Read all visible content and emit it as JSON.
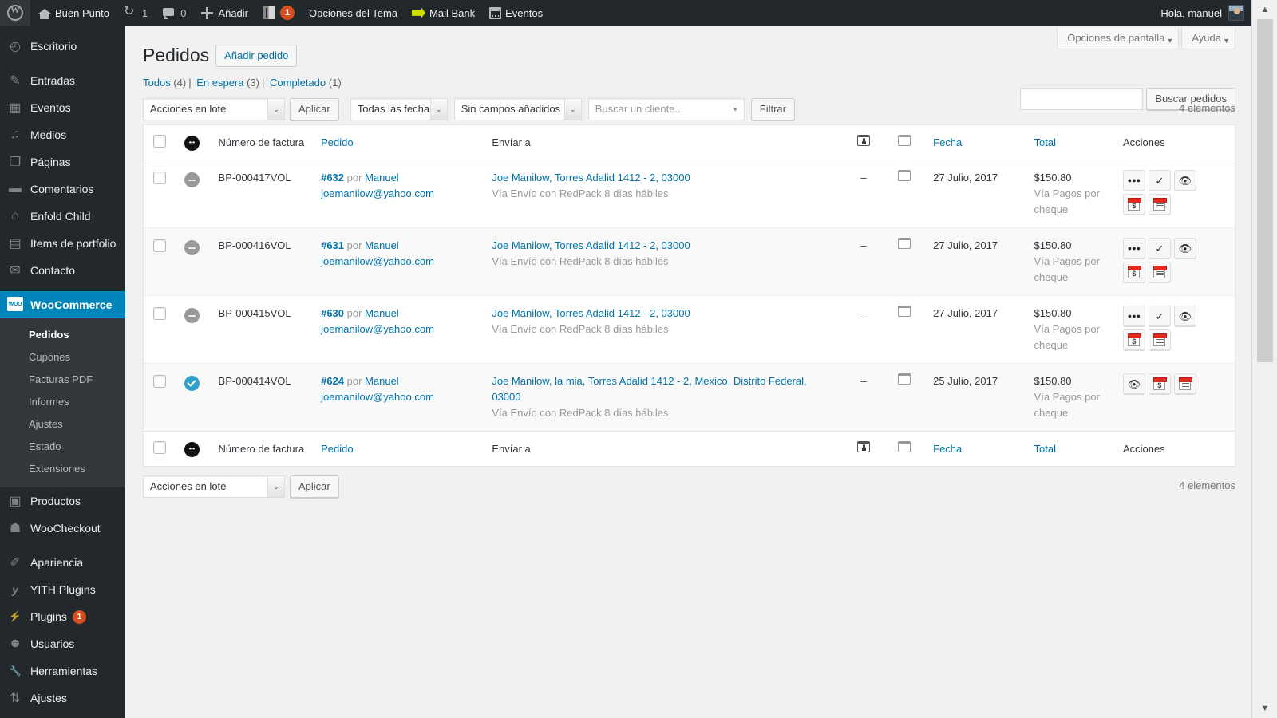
{
  "adminbar": {
    "logo_icon": "wordpress-logo-icon",
    "site_name": "Buen Punto",
    "updates_count": "1",
    "comments_count": "0",
    "new_label": "Añadir",
    "theme_badge": "1",
    "theme_options_label": "Opciones del Tema",
    "mail_bank_label": "Mail Bank",
    "events_label": "Eventos",
    "greeting": "Hola, manuel"
  },
  "sidebar": {
    "items": [
      {
        "label": "Escritorio",
        "icon": "dashboard-icon",
        "glyph": "◴",
        "current": false
      },
      {
        "label": "Entradas",
        "icon": "pin-icon",
        "glyph": "✎",
        "current": false
      },
      {
        "label": "Eventos",
        "icon": "calendar-icon",
        "glyph": "▦",
        "current": false
      },
      {
        "label": "Medios",
        "icon": "media-icon",
        "glyph": "♪",
        "current": false
      },
      {
        "label": "Páginas",
        "icon": "pages-icon",
        "glyph": "❐",
        "current": false
      },
      {
        "label": "Comentarios",
        "icon": "comments-icon",
        "glyph": "▬",
        "current": false
      },
      {
        "label": "Enfold Child",
        "icon": "home-icon",
        "glyph": "⌂",
        "current": false
      },
      {
        "label": "Items de portfolio",
        "icon": "portfolio-icon",
        "glyph": "▤",
        "current": false
      },
      {
        "label": "Contacto",
        "icon": "envelope-icon",
        "glyph": "✉",
        "current": false
      },
      {
        "label": "WooCommerce",
        "icon": "woocommerce-icon",
        "glyph": "WOO",
        "current": true
      },
      {
        "label": "Productos",
        "icon": "products-icon",
        "glyph": "▣",
        "current": false
      },
      {
        "label": "WooCheckout",
        "icon": "checkout-icon",
        "glyph": "☗",
        "current": false
      },
      {
        "label": "Apariencia",
        "icon": "brush-icon",
        "glyph": "✐",
        "current": false
      },
      {
        "label": "YITH Plugins",
        "icon": "yith-icon",
        "glyph": "y",
        "current": false
      },
      {
        "label": "Plugins",
        "icon": "plug-icon",
        "glyph": "⚡",
        "current": false,
        "badge": "1"
      },
      {
        "label": "Usuarios",
        "icon": "users-icon",
        "glyph": "☻",
        "current": false
      },
      {
        "label": "Herramientas",
        "icon": "tools-icon",
        "glyph": "🔧",
        "current": false
      },
      {
        "label": "Ajustes",
        "icon": "settings-icon",
        "glyph": "⇅",
        "current": false
      }
    ],
    "submenu": [
      {
        "label": "Pedidos",
        "current": true
      },
      {
        "label": "Cupones",
        "current": false
      },
      {
        "label": "Facturas PDF",
        "current": false
      },
      {
        "label": "Informes",
        "current": false
      },
      {
        "label": "Ajustes",
        "current": false
      },
      {
        "label": "Estado",
        "current": false
      },
      {
        "label": "Extensiones",
        "current": false
      }
    ]
  },
  "screen_meta": {
    "screen_options": "Opciones de pantalla",
    "help": "Ayuda",
    "caret": "▼"
  },
  "page": {
    "title": "Pedidos",
    "add_button": "Añadir pedido"
  },
  "status_filters": [
    {
      "label": "Todos",
      "count": "(4)"
    },
    {
      "label": "En espera",
      "count": "(3)"
    },
    {
      "label": "Completado",
      "count": "(1)"
    }
  ],
  "search": {
    "value": "",
    "placeholder": "",
    "button": "Buscar pedidos"
  },
  "tablenav_top": {
    "bulk_action": "Acciones en lote",
    "apply": "Aplicar",
    "dates": "Todas las fechas",
    "fields": "Sin campos añadidos",
    "customer": "Buscar un cliente...",
    "filter": "Filtrar",
    "count": "4 elementos",
    "caret": "⌄"
  },
  "tablenav_bottom": {
    "bulk_action": "Acciones en lote",
    "apply": "Aplicar",
    "count": "4 elementos",
    "caret": "⌄"
  },
  "table": {
    "columns": {
      "cb": "",
      "status": "status-icon",
      "invoice": "Número de factura",
      "order": "Pedido",
      "ship_to": "Envíar a",
      "note_customer": "customer-message-icon",
      "note_order": "order-note-icon",
      "date": "Fecha",
      "total": "Total",
      "actions": "Acciones"
    },
    "rows": [
      {
        "invoice": "BP-000417VOL",
        "status": "onhold",
        "order_number": "#632",
        "order_by": "por",
        "order_customer": "Manuel",
        "order_email": "joemanilow@yahoo.com",
        "ship_to": "Joe Manilow, Torres Adalid 1412 - 2, 03000",
        "ship_via": "Vía Envío con RedPack 8 días hábiles",
        "customer_note": "–",
        "order_note": "note-icon",
        "date": "27 Julio, 2017",
        "total": "$150.80",
        "payment_via": "Vía Pagos por cheque",
        "actions": [
          "processing-icon",
          "complete-icon",
          "view-icon",
          "invoice-pdf-icon",
          "packingslip-pdf-icon"
        ]
      },
      {
        "invoice": "BP-000416VOL",
        "status": "onhold",
        "order_number": "#631",
        "order_by": "por",
        "order_customer": "Manuel",
        "order_email": "joemanilow@yahoo.com",
        "ship_to": "Joe Manilow, Torres Adalid 1412 - 2, 03000",
        "ship_via": "Vía Envío con RedPack 8 días hábiles",
        "customer_note": "–",
        "order_note": "note-icon",
        "date": "27 Julio, 2017",
        "total": "$150.80",
        "payment_via": "Vía Pagos por cheque",
        "actions": [
          "processing-icon",
          "complete-icon",
          "view-icon",
          "invoice-pdf-icon",
          "packingslip-pdf-icon"
        ]
      },
      {
        "invoice": "BP-000415VOL",
        "status": "onhold",
        "order_number": "#630",
        "order_by": "por",
        "order_customer": "Manuel",
        "order_email": "joemanilow@yahoo.com",
        "ship_to": "Joe Manilow, Torres Adalid 1412 - 2, 03000",
        "ship_via": "Vía Envío con RedPack 8 días hábiles",
        "customer_note": "–",
        "order_note": "note-icon",
        "date": "27 Julio, 2017",
        "total": "$150.80",
        "payment_via": "Vía Pagos por cheque",
        "actions": [
          "processing-icon",
          "complete-icon",
          "view-icon",
          "invoice-pdf-icon",
          "packingslip-pdf-icon"
        ]
      },
      {
        "invoice": "BP-000414VOL",
        "status": "completed",
        "order_number": "#624",
        "order_by": "por",
        "order_customer": "Manuel",
        "order_email": "joemanilow@yahoo.com",
        "ship_to": "Joe Manilow, la mia, Torres Adalid 1412 - 2, Mexico, Distrito Federal, 03000",
        "ship_via": "Vía Envío con RedPack 8 días hábiles",
        "customer_note": "–",
        "order_note": "note-icon",
        "date": "25 Julio, 2017",
        "total": "$150.80",
        "payment_via": "Vía Pagos por cheque",
        "actions": [
          "view-icon",
          "invoice-pdf-icon",
          "packingslip-pdf-icon"
        ]
      }
    ]
  },
  "colors": {
    "adminbar_bg": "#23282d",
    "sidebar_bg": "#23282d",
    "submenu_bg": "#32373c",
    "accent_blue": "#0073aa",
    "woo_highlight": "#0085ba",
    "link": "#0073aa",
    "badge_orange": "#d54e21",
    "completed_blue": "#2ea2cc",
    "onhold_gray": "#999999",
    "pdf_red": "#e02b20",
    "page_bg": "#f1f1f1"
  },
  "scrollbar": {
    "up": "︿",
    "down": "﹀"
  }
}
